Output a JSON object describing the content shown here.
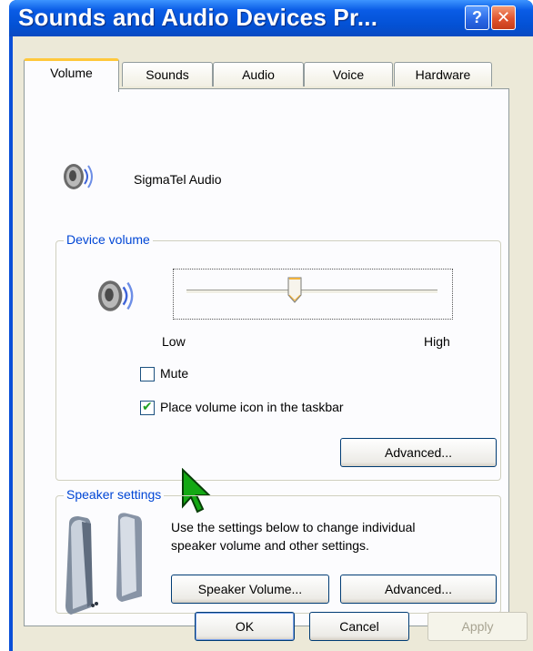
{
  "window": {
    "title": "Sounds and Audio Devices Pr...",
    "help_label": "?",
    "close_label": "✕"
  },
  "tabs": [
    {
      "label": "Volume",
      "active": true
    },
    {
      "label": "Sounds",
      "active": false
    },
    {
      "label": "Audio",
      "active": false
    },
    {
      "label": "Voice",
      "active": false
    },
    {
      "label": "Hardware",
      "active": false
    }
  ],
  "device": {
    "name": "SigmaTel Audio",
    "icon": "speaker-icon"
  },
  "device_volume": {
    "group_label": "Device volume",
    "low_label": "Low",
    "high_label": "High",
    "level": 0.43,
    "mute_label": "Mute",
    "mute_checked": false,
    "taskbar_label": "Place volume icon in the taskbar",
    "taskbar_checked": true,
    "advanced_label": "Advanced..."
  },
  "speaker_settings": {
    "group_label": "Speaker settings",
    "description_line1": "Use the settings below to change individual",
    "description_line2": "speaker volume and other settings.",
    "speaker_volume_label": "Speaker Volume...",
    "advanced_label": "Advanced..."
  },
  "footer": {
    "ok_label": "OK",
    "cancel_label": "Cancel",
    "apply_label": "Apply"
  }
}
